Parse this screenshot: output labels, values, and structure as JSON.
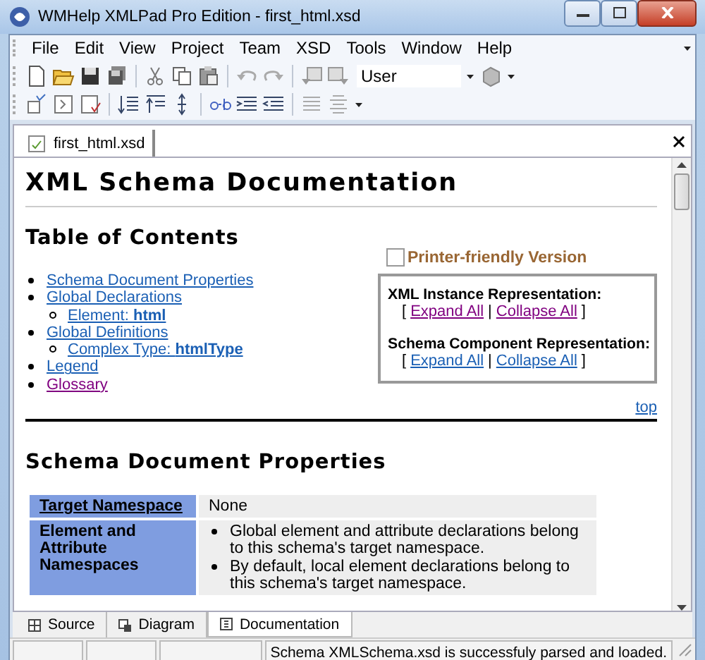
{
  "window": {
    "title": "WMHelp XMLPad Pro Edition - first_html.xsd"
  },
  "menu": [
    {
      "label": "File"
    },
    {
      "label": "Edit"
    },
    {
      "label": "View"
    },
    {
      "label": "Project"
    },
    {
      "label": "Team"
    },
    {
      "label": "XSD"
    },
    {
      "label": "Tools"
    },
    {
      "label": "Window"
    },
    {
      "label": "Help"
    }
  ],
  "toolbar": {
    "profile_combo": {
      "value": "User"
    }
  },
  "document_tabs": [
    {
      "label": "first_html.xsd",
      "selected": true
    }
  ],
  "document": {
    "heading": "XML Schema Documentation",
    "toc": {
      "title": "Table of Contents",
      "items": [
        {
          "label": "Schema Document Properties",
          "visited": false
        },
        {
          "label": "Global Declarations",
          "visited": false,
          "children": [
            {
              "label": "Element: **html**",
              "visited": false
            }
          ]
        },
        {
          "label": "Global Definitions",
          "visited": false,
          "children": [
            {
              "label": "Complex Type: **htmlType**",
              "visited": false
            }
          ]
        },
        {
          "label": "Legend",
          "visited": false
        },
        {
          "label": "Glossary",
          "visited": true
        }
      ]
    },
    "printer_friendly": {
      "label": "Printer-friendly Version",
      "checked": false
    },
    "representations": [
      {
        "title": "XML Instance Representation:",
        "prefix": "[",
        "separator": "|",
        "suffix": "]",
        "links": [
          {
            "label": "Expand All",
            "visited": true
          },
          {
            "label": "Collapse All",
            "visited": true
          }
        ]
      },
      {
        "title": "Schema Component Representation:",
        "prefix": "[",
        "separator": "|",
        "suffix": "]",
        "links": [
          {
            "label": "Expand All",
            "visited": false
          },
          {
            "label": "Collapse All",
            "visited": false
          }
        ]
      }
    ],
    "top_link": "top",
    "section": {
      "title": "Schema Document Properties",
      "rows": [
        {
          "kind": "link",
          "label": "Target Namespace",
          "value": "None"
        },
        {
          "kind": "bullets",
          "label": "Element and Attribute Namespaces",
          "bullets": [
            "Global element and attribute declarations belong to this schema's target namespace.",
            "By default, local element declarations belong to this schema's target namespace."
          ]
        }
      ]
    }
  },
  "bottom_tabs": [
    {
      "label": "Source",
      "selected": false
    },
    {
      "label": "Diagram",
      "selected": false
    },
    {
      "label": "Documentation",
      "selected": true
    }
  ],
  "status_bar": {
    "message": "Schema XMLSchema.xsd is successfuly parsed and loaded."
  }
}
